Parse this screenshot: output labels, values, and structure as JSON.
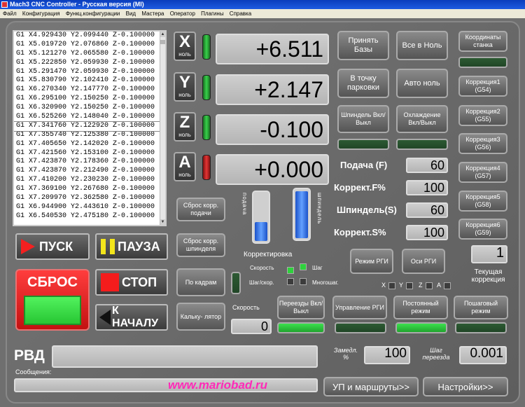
{
  "window": {
    "title": "Mach3 CNC Controller - Русская версия (MI)"
  },
  "menu": [
    "Файл",
    "Конфигурация",
    "Функц.конфигурации",
    "Вид",
    "Мастера",
    "Оператор",
    "Плагины",
    "Справка"
  ],
  "gcode_lines": [
    "G1 X4.929430 Y2.099440 Z-0.100000",
    "G1 X5.019720 Y2.076860 Z-0.100000",
    "G1 X5.121270 Y2.065580 Z-0.100000",
    "G1 X5.222850 Y2.059930 Z-0.100000",
    "G1 X5.291470 Y2.059930 Z-0.100000",
    "G1 X5.830790 Y2.102410 Z-0.100000",
    "G1 X6.270340 Y2.147770 Z-0.100000",
    "G1 X6.295100 Y2.150250 Z-0.100000",
    "G1 X6.320900 Y2.150250 Z-0.100000",
    "G1 X6.525260 Y2.148040 Z-0.100000",
    "G1 X7.341760 Y2.122920 Z-0.100000",
    "G1 X7.355740 Y2.125380 Z-0.100000",
    "G1 X7.405650 Y2.142020 Z-0.100000",
    "G1 X7.421560 Y2.153100 Z-0.100000",
    "G1 X7.423870 Y2.178360 Z-0.100000",
    "G1 X7.423870 Y2.212490 Z-0.100000",
    "G1 X7.410200 Y2.230230 Z-0.100000",
    "G1 X7.369100 Y2.267680 Z-0.100000",
    "G1 X7.209970 Y2.362580 Z-0.100000",
    "G1 X6.944900 Y2.443610 Z-0.100000",
    "G1 X6.540530 Y2.475180 Z-0.100000"
  ],
  "axes": [
    {
      "letter": "X",
      "sub": "ноль",
      "value": "+6.511",
      "led": "green"
    },
    {
      "letter": "Y",
      "sub": "ноль",
      "value": "+2.147",
      "led": "green"
    },
    {
      "letter": "Z",
      "sub": "ноль",
      "value": "-0.100",
      "led": "green"
    },
    {
      "letter": "A",
      "sub": "ноль",
      "value": "+0.000",
      "led": "red"
    }
  ],
  "buttons": {
    "accept_bases": "Принять Базы",
    "all_zero": "Все в Ноль",
    "goto_park": "В точку парковки",
    "auto_zero": "Авто ноль",
    "spindle_toggle": "Шпиндель Вкл/Выкл",
    "cooling_toggle": "Охлаждение Вкл/Выкл",
    "machine_coords": "Координаты станка",
    "corr1": "Коррекция1 (G54)",
    "corr2": "Коррекция2 (G55)",
    "corr3": "Коррекция3 (G56)",
    "corr4": "Коррекция4 (G57)",
    "corr5": "Коррекция5 (G58)",
    "corr6": "Коррекция6 (G59)",
    "reset_feed": "Сброс корр. подачи",
    "reset_spindle": "Сброс корр. шпинделя",
    "by_frames": "По кадрам",
    "calculator": "Кальку- лятор",
    "mode_rgi": "Режим РГИ",
    "axes_rgi": "Оси РГИ",
    "jog_toggle": "Переезды Вкл/Выкл",
    "control_rgi": "Управление РГИ",
    "const_mode": "Постоянный режим",
    "step_mode": "Пошаговый режим",
    "start": "ПУСК",
    "pause": "ПАУЗА",
    "reset": "СБРОС",
    "stop": "СТОП",
    "to_start": "К НАЧАЛУ",
    "programs_routes": "УП и маршруты>>",
    "settings": "Настройки>>"
  },
  "fields": {
    "feed_label": "Подача (F)",
    "feed_value": "60",
    "feed_corr_label": "Коррект.F%",
    "feed_corr_value": "100",
    "spindle_label": "Шпиндель(S)",
    "spindle_value": "60",
    "spindle_corr_label": "Коррект.S%",
    "spindle_corr_value": "100",
    "speed_label": "Скорость",
    "speed_value": "0",
    "current_corr_value": "1",
    "current_corr_label": "Текущая коррекция",
    "slow_label": "Замедл. %",
    "slow_value": "100",
    "jog_step_label": "Шаг переезда",
    "jog_step_value": "0.001"
  },
  "gauges": {
    "feed_label": "подача",
    "feed_level": 0.38,
    "spindle_label": "шпиндель",
    "spindle_level": 0.93,
    "corr_label": "Корректировка"
  },
  "jog_options": {
    "speed": "Скорость",
    "step": "Шаг",
    "step_cont": "Шаг/скор.",
    "multi": "Многошаг."
  },
  "axis_indicators": [
    "X",
    "Y",
    "Z",
    "A"
  ],
  "status": {
    "rvd_label": "РВД",
    "messages_label": "Сообщения:",
    "url": "www.mariobad.ru"
  }
}
